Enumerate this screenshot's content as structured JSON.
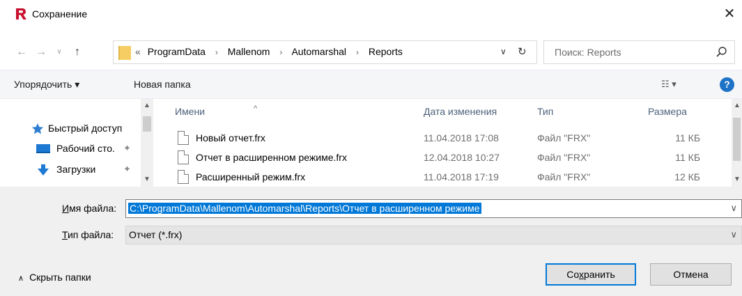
{
  "window": {
    "title": "Сохранение",
    "close_glyph": "✕",
    "app_icon": "fastreport-icon"
  },
  "address": {
    "prefix": "«",
    "crumbs": [
      "ProgramData",
      "Mallenom",
      "Automarshal",
      "Reports"
    ],
    "separator": "›"
  },
  "search": {
    "placeholder": "Поиск: Reports"
  },
  "toolbar": {
    "organize_label": "Упорядочить ▾",
    "new_folder_label": "Новая папка",
    "view_label": "☷ ▾",
    "help_label": "?"
  },
  "sidebar": {
    "items": [
      {
        "label": "Быстрый доступ",
        "icon": "star-icon"
      },
      {
        "label": "Рабочий сто.",
        "icon": "desktop-icon"
      },
      {
        "label": "Загрузки",
        "icon": "download-icon"
      }
    ]
  },
  "filelist": {
    "headers": {
      "name": "Имени",
      "date": "Дата изменения",
      "type": "Тип",
      "size": "Размера"
    },
    "rows": [
      {
        "name": "Новый отчет.frx",
        "date": "11.04.2018 17:08",
        "type": "Файл \"FRX\"",
        "size": "11 КБ"
      },
      {
        "name": "Отчет в расширенном режиме.frx",
        "date": "12.04.2018 10:27",
        "type": "Файл \"FRX\"",
        "size": "11 КБ"
      },
      {
        "name": "Расширенный режим.frx",
        "date": "11.04.2018 17:19",
        "type": "Файл \"FRX\"",
        "size": "12 КБ"
      }
    ]
  },
  "form": {
    "filename_label_underlined": "И",
    "filename_label_rest": "мя файла:",
    "filename_value": "C:\\ProgramData\\Mallenom\\Automarshal\\Reports\\Отчет в расширенном режиме",
    "filetype_label_underlined": "Т",
    "filetype_label_rest": "ип файла:",
    "filetype_value": "Отчет (*.frx)",
    "hide_folders_label": "Скрыть папки",
    "save_label_pre": "Со",
    "save_label_underlined": "х",
    "save_label_post": "ранить",
    "cancel_label": "Отмена"
  },
  "colors": {
    "accent": "#0078d7",
    "help": "#1e73c6",
    "folder": "#f5cd62",
    "brand_red": "#c8102e"
  }
}
